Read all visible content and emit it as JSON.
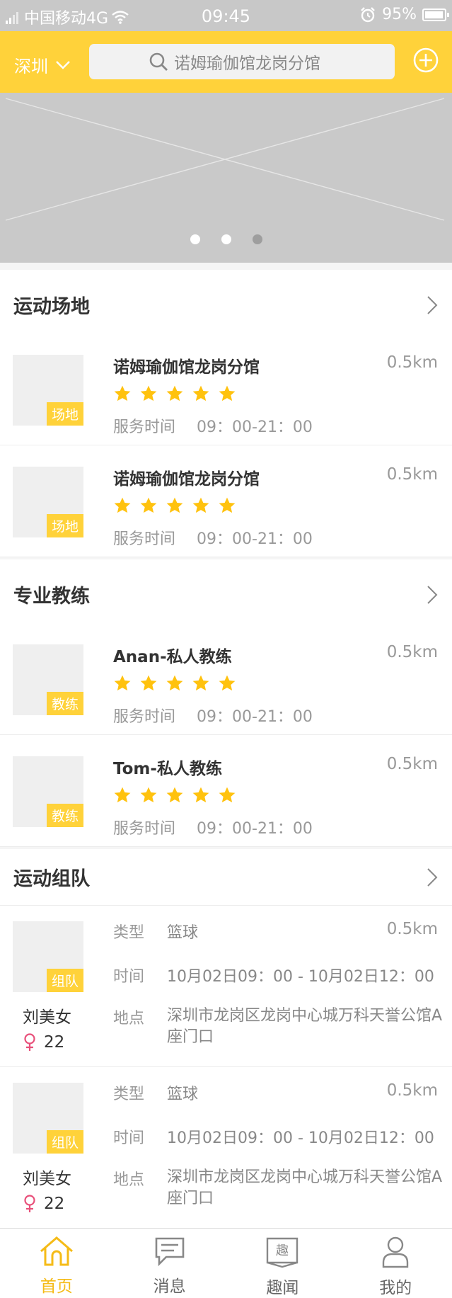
{
  "status_bar": {
    "carrier": "中国移动4G",
    "time": "09:45",
    "battery": "95%",
    "battery_level": 0.95
  },
  "header": {
    "city": "深圳",
    "search_text": "诺姆瑜伽馆龙岗分馆"
  },
  "banner": {
    "active_dot": 2,
    "dot_count": 3
  },
  "sections": {
    "venues": {
      "title": "运动场地"
    },
    "coaches": {
      "title": "专业教练"
    },
    "teams": {
      "title": "运动组队"
    }
  },
  "venues": [
    {
      "name": "诺姆瑜伽馆龙岗分馆",
      "distance": "0.5km",
      "tag": "场地",
      "stars": 5,
      "service_label": "服务时间",
      "service_time": "09：00-21：00"
    },
    {
      "name": "诺姆瑜伽馆龙岗分馆",
      "distance": "0.5km",
      "tag": "场地",
      "stars": 5,
      "service_label": "服务时间",
      "service_time": "09：00-21：00"
    }
  ],
  "coaches": [
    {
      "name": "Anan-私人教练",
      "distance": "0.5km",
      "tag": "教练",
      "stars": 5,
      "service_label": "服务时间",
      "service_time": "09：00-21：00"
    },
    {
      "name": "Tom-私人教练",
      "distance": "0.5km",
      "tag": "教练",
      "stars": 5,
      "service_label": "服务时间",
      "service_time": "09：00-21：00"
    }
  ],
  "teams": [
    {
      "tag": "组队",
      "person": "刘美女",
      "age": "22",
      "distance": "0.5km",
      "type_label": "类型",
      "type": "篮球",
      "time_label": "时间",
      "time": "10月02日09：00 - 10月02日12：00",
      "place_label": "地点",
      "place": "深圳市龙岗区龙岗中心城万科天誉公馆A座门口"
    },
    {
      "tag": "组队",
      "person": "刘美女",
      "age": "22",
      "distance": "0.5km",
      "type_label": "类型",
      "type": "篮球",
      "time_label": "时间",
      "time": "10月02日09：00 - 10月02日12：00",
      "place_label": "地点",
      "place": "深圳市龙岗区龙岗中心城万科天誉公馆A座门口"
    }
  ],
  "tabbar": {
    "tabs": [
      {
        "label": "首页",
        "icon": "home-icon",
        "active": true
      },
      {
        "label": "消息",
        "icon": "message-icon",
        "active": false
      },
      {
        "label": "趣闻",
        "icon": "news-icon",
        "active": false,
        "icon_text": "趣"
      },
      {
        "label": "我的",
        "icon": "profile-icon",
        "active": false
      }
    ]
  },
  "colors": {
    "accent": "#ffd23a",
    "star": "#ffc20e",
    "active_tab": "#f5bb17",
    "female": "#e8507a"
  }
}
